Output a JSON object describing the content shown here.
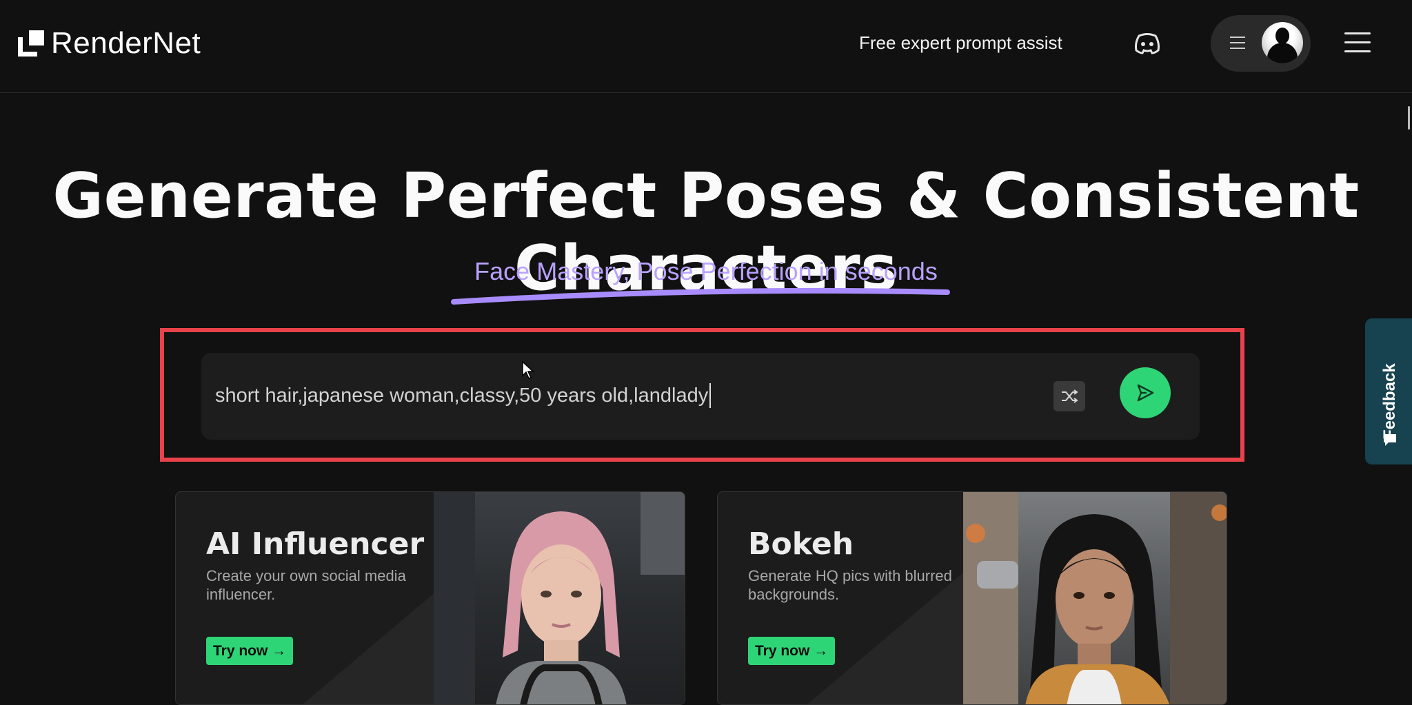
{
  "header": {
    "brand": "RenderNet",
    "nav_link": "Free expert prompt assist"
  },
  "hero": {
    "title": "Generate Perfect Poses & Consistent Characters",
    "subtitle": "Face Mastery, Pose Perfection in seconds"
  },
  "prompt": {
    "value": "short hair,japanese woman,classy,50 years old,landlady"
  },
  "feedback": {
    "label": "Feedback"
  },
  "cards": [
    {
      "title": "AI Influencer",
      "description": "Create your own social media influencer.",
      "button": "Try now →"
    },
    {
      "title": "Bokeh",
      "description": "Generate HQ pics with blurred backgrounds.",
      "button": "Try now →"
    }
  ],
  "colors": {
    "background": "#111111",
    "accent_green": "#2ed576",
    "subtitle_purple": "#b9a2ff",
    "highlight_red": "#e8424a",
    "feedback_bg": "#17424f"
  },
  "icons": {
    "discord": "discord-icon",
    "menu": "hamburger-icon",
    "shuffle": "shuffle-icon",
    "send": "send-icon",
    "feedback": "chat-bubble-icon"
  }
}
